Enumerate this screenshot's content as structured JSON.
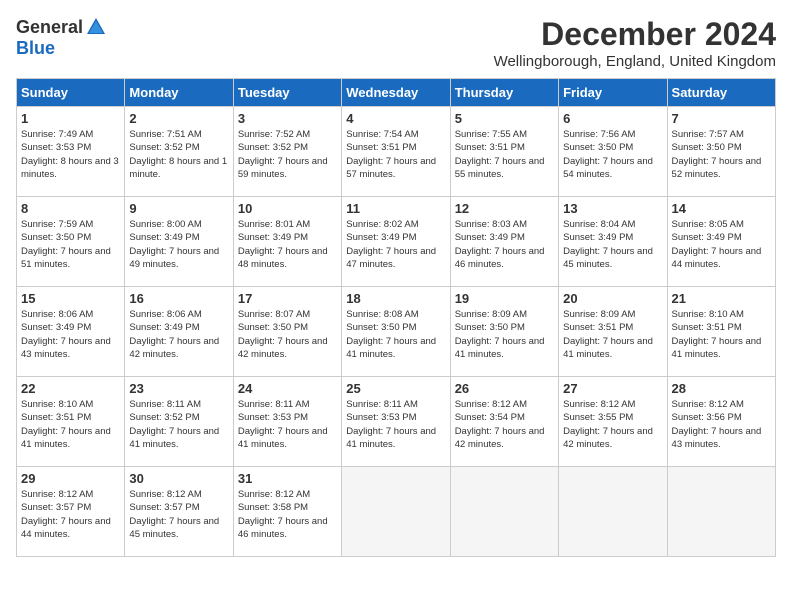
{
  "logo": {
    "general": "General",
    "blue": "Blue"
  },
  "title": "December 2024",
  "location": "Wellingborough, England, United Kingdom",
  "days_header": [
    "Sunday",
    "Monday",
    "Tuesday",
    "Wednesday",
    "Thursday",
    "Friday",
    "Saturday"
  ],
  "weeks": [
    [
      {
        "day": "1",
        "sunrise": "7:49 AM",
        "sunset": "3:53 PM",
        "daylight": "8 hours and 3 minutes."
      },
      {
        "day": "2",
        "sunrise": "7:51 AM",
        "sunset": "3:52 PM",
        "daylight": "8 hours and 1 minute."
      },
      {
        "day": "3",
        "sunrise": "7:52 AM",
        "sunset": "3:52 PM",
        "daylight": "7 hours and 59 minutes."
      },
      {
        "day": "4",
        "sunrise": "7:54 AM",
        "sunset": "3:51 PM",
        "daylight": "7 hours and 57 minutes."
      },
      {
        "day": "5",
        "sunrise": "7:55 AM",
        "sunset": "3:51 PM",
        "daylight": "7 hours and 55 minutes."
      },
      {
        "day": "6",
        "sunrise": "7:56 AM",
        "sunset": "3:50 PM",
        "daylight": "7 hours and 54 minutes."
      },
      {
        "day": "7",
        "sunrise": "7:57 AM",
        "sunset": "3:50 PM",
        "daylight": "7 hours and 52 minutes."
      }
    ],
    [
      {
        "day": "8",
        "sunrise": "7:59 AM",
        "sunset": "3:50 PM",
        "daylight": "7 hours and 51 minutes."
      },
      {
        "day": "9",
        "sunrise": "8:00 AM",
        "sunset": "3:49 PM",
        "daylight": "7 hours and 49 minutes."
      },
      {
        "day": "10",
        "sunrise": "8:01 AM",
        "sunset": "3:49 PM",
        "daylight": "7 hours and 48 minutes."
      },
      {
        "day": "11",
        "sunrise": "8:02 AM",
        "sunset": "3:49 PM",
        "daylight": "7 hours and 47 minutes."
      },
      {
        "day": "12",
        "sunrise": "8:03 AM",
        "sunset": "3:49 PM",
        "daylight": "7 hours and 46 minutes."
      },
      {
        "day": "13",
        "sunrise": "8:04 AM",
        "sunset": "3:49 PM",
        "daylight": "7 hours and 45 minutes."
      },
      {
        "day": "14",
        "sunrise": "8:05 AM",
        "sunset": "3:49 PM",
        "daylight": "7 hours and 44 minutes."
      }
    ],
    [
      {
        "day": "15",
        "sunrise": "8:06 AM",
        "sunset": "3:49 PM",
        "daylight": "7 hours and 43 minutes."
      },
      {
        "day": "16",
        "sunrise": "8:06 AM",
        "sunset": "3:49 PM",
        "daylight": "7 hours and 42 minutes."
      },
      {
        "day": "17",
        "sunrise": "8:07 AM",
        "sunset": "3:50 PM",
        "daylight": "7 hours and 42 minutes."
      },
      {
        "day": "18",
        "sunrise": "8:08 AM",
        "sunset": "3:50 PM",
        "daylight": "7 hours and 41 minutes."
      },
      {
        "day": "19",
        "sunrise": "8:09 AM",
        "sunset": "3:50 PM",
        "daylight": "7 hours and 41 minutes."
      },
      {
        "day": "20",
        "sunrise": "8:09 AM",
        "sunset": "3:51 PM",
        "daylight": "7 hours and 41 minutes."
      },
      {
        "day": "21",
        "sunrise": "8:10 AM",
        "sunset": "3:51 PM",
        "daylight": "7 hours and 41 minutes."
      }
    ],
    [
      {
        "day": "22",
        "sunrise": "8:10 AM",
        "sunset": "3:51 PM",
        "daylight": "7 hours and 41 minutes."
      },
      {
        "day": "23",
        "sunrise": "8:11 AM",
        "sunset": "3:52 PM",
        "daylight": "7 hours and 41 minutes."
      },
      {
        "day": "24",
        "sunrise": "8:11 AM",
        "sunset": "3:53 PM",
        "daylight": "7 hours and 41 minutes."
      },
      {
        "day": "25",
        "sunrise": "8:11 AM",
        "sunset": "3:53 PM",
        "daylight": "7 hours and 41 minutes."
      },
      {
        "day": "26",
        "sunrise": "8:12 AM",
        "sunset": "3:54 PM",
        "daylight": "7 hours and 42 minutes."
      },
      {
        "day": "27",
        "sunrise": "8:12 AM",
        "sunset": "3:55 PM",
        "daylight": "7 hours and 42 minutes."
      },
      {
        "day": "28",
        "sunrise": "8:12 AM",
        "sunset": "3:56 PM",
        "daylight": "7 hours and 43 minutes."
      }
    ],
    [
      {
        "day": "29",
        "sunrise": "8:12 AM",
        "sunset": "3:57 PM",
        "daylight": "7 hours and 44 minutes."
      },
      {
        "day": "30",
        "sunrise": "8:12 AM",
        "sunset": "3:57 PM",
        "daylight": "7 hours and 45 minutes."
      },
      {
        "day": "31",
        "sunrise": "8:12 AM",
        "sunset": "3:58 PM",
        "daylight": "7 hours and 46 minutes."
      },
      null,
      null,
      null,
      null
    ]
  ]
}
